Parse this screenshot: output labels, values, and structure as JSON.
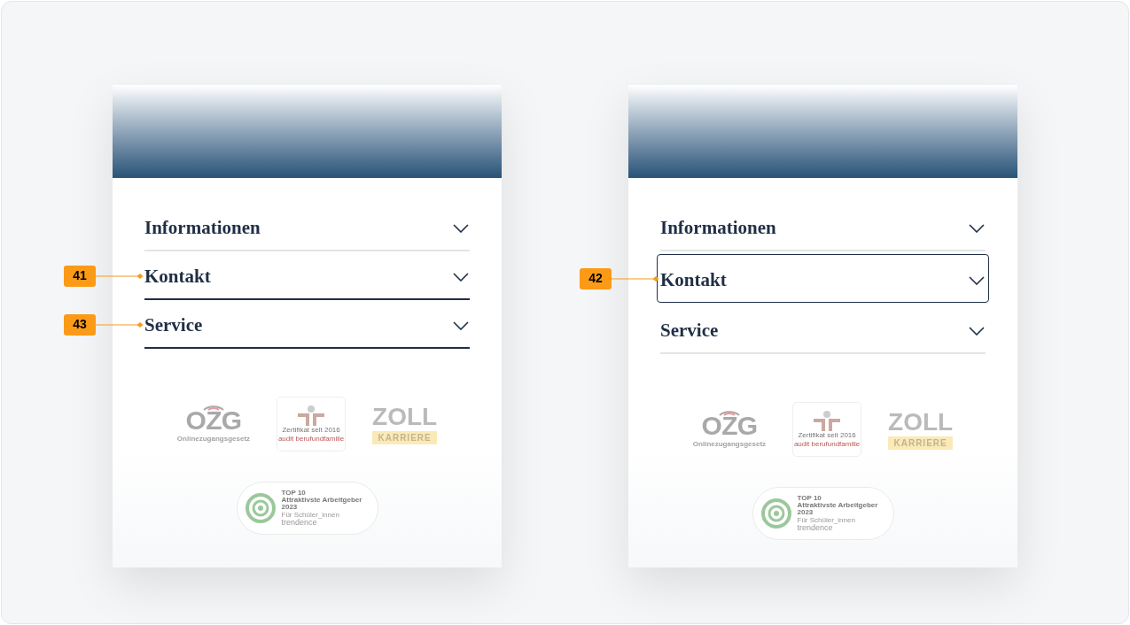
{
  "panels": [
    {
      "items": [
        {
          "label": "Informationen",
          "hovered": false,
          "focused": false
        },
        {
          "label": "Kontakt",
          "hovered": true,
          "focused": false,
          "annotation": "41"
        },
        {
          "label": "Service",
          "hovered": true,
          "focused": false,
          "annotation": "43"
        }
      ],
      "logos": {
        "ozg": {
          "mark": "OZG",
          "caption": "Onlinezugangsgesetz"
        },
        "certificate": {
          "line1": "Zertifikat seit 2016",
          "line2": "audit berufundfamilie"
        },
        "zoll": {
          "title": "ZOLL",
          "band": "KARRIERE"
        },
        "award": {
          "lines": [
            "TOP 10",
            "Attraktivste Arbeitgeber",
            "2023"
          ],
          "sub": "Für Schüler_innen",
          "brand": "trendence"
        }
      }
    },
    {
      "items": [
        {
          "label": "Informationen",
          "hovered": false,
          "focused": false
        },
        {
          "label": "Kontakt",
          "hovered": false,
          "focused": true,
          "annotation": "42"
        },
        {
          "label": "Service",
          "hovered": false,
          "focused": false
        }
      ],
      "logos": {
        "ozg": {
          "mark": "OZG",
          "caption": "Onlinezugangsgesetz"
        },
        "certificate": {
          "line1": "Zertifikat seit 2016",
          "line2": "audit berufundfamilie"
        },
        "zoll": {
          "title": "ZOLL",
          "band": "KARRIERE"
        },
        "award": {
          "lines": [
            "TOP 10",
            "Attraktivste Arbeitgeber",
            "2023"
          ],
          "sub": "Für Schüler_innen",
          "brand": "trendence"
        }
      }
    }
  ]
}
